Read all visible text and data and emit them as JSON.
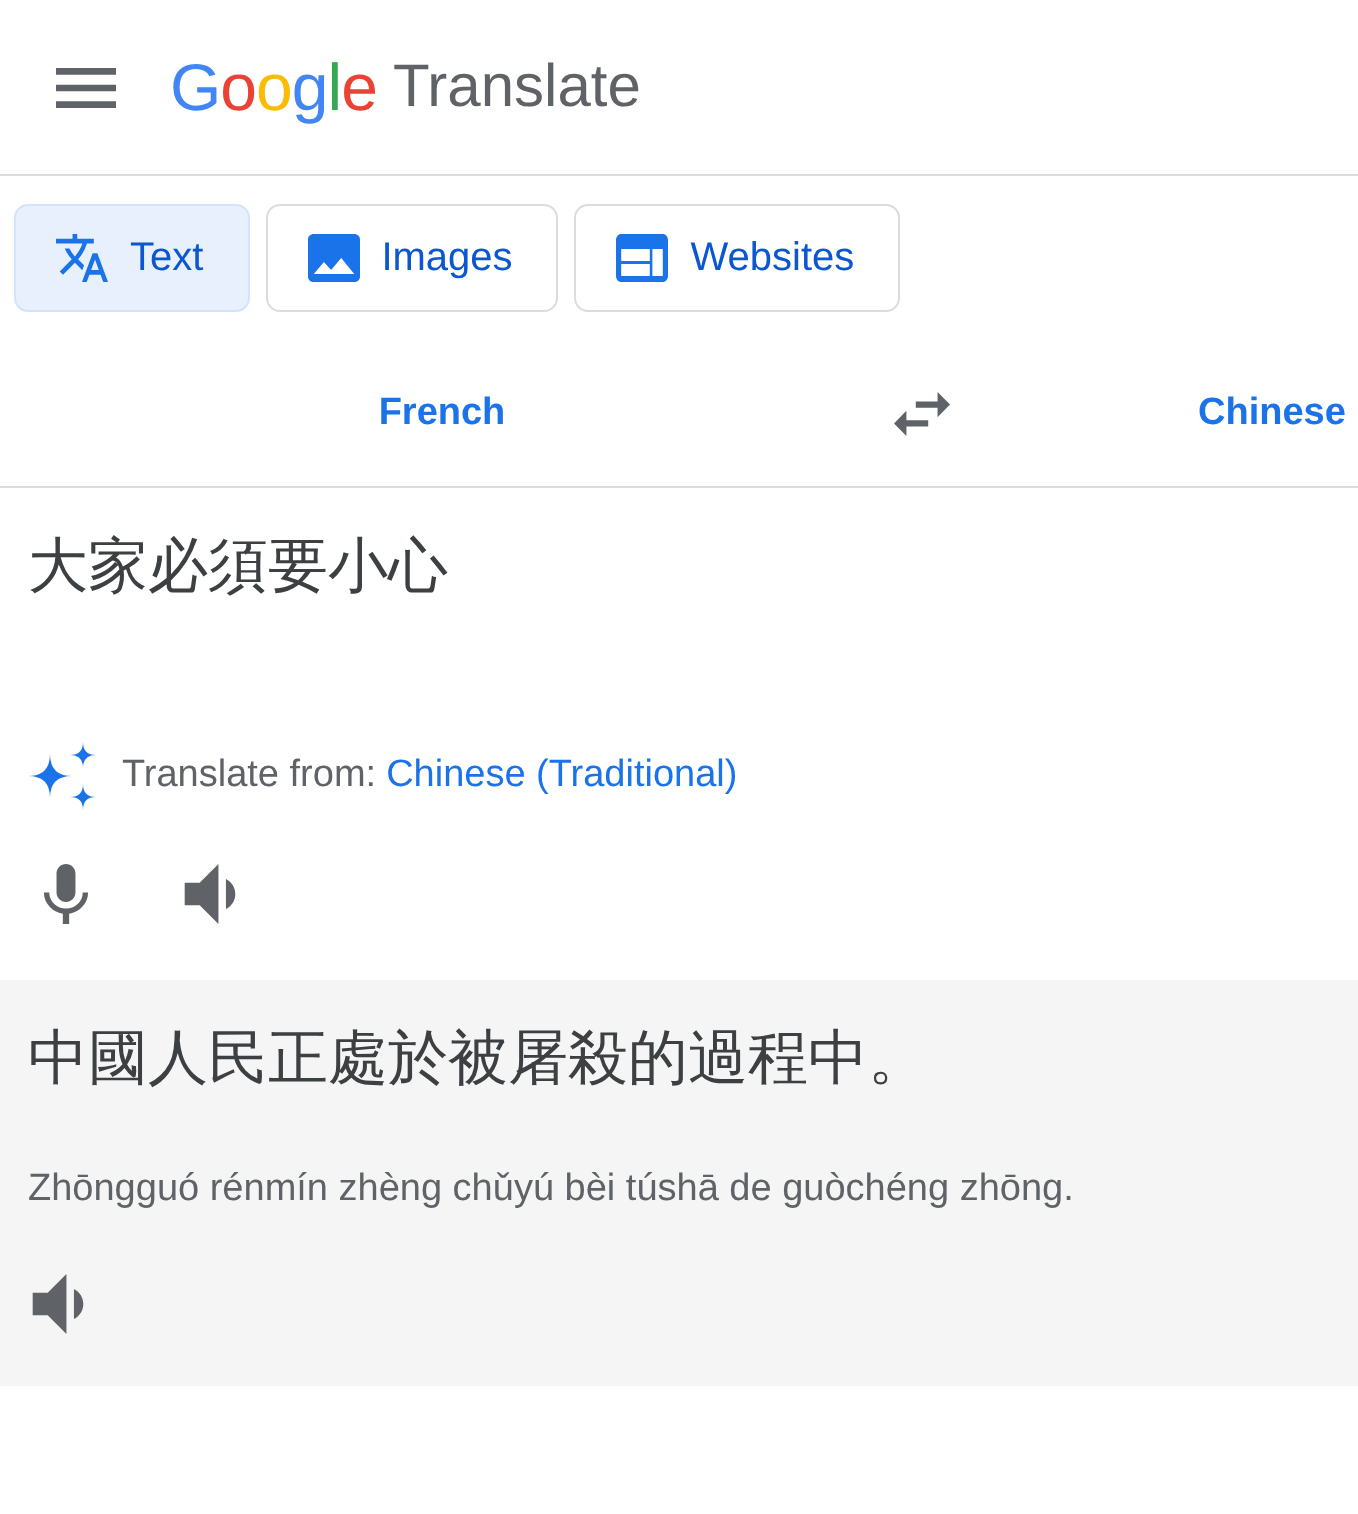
{
  "header": {
    "brand": "Google",
    "product": "Translate"
  },
  "modes": [
    {
      "label": "Text",
      "selected": true
    },
    {
      "label": "Images",
      "selected": false
    },
    {
      "label": "Websites",
      "selected": false
    }
  ],
  "languages": {
    "source": "French",
    "target": "Chinese"
  },
  "source": {
    "text": "大家必須要小心",
    "detected_prefix": "Translate from:",
    "detected_language": "Chinese (Traditional)"
  },
  "output": {
    "text": "中國人民正處於被屠殺的過程中。",
    "romanization": "Zhōngguó rénmín zhèng chǔyú bèi túshā de guòchéng zhōng."
  }
}
